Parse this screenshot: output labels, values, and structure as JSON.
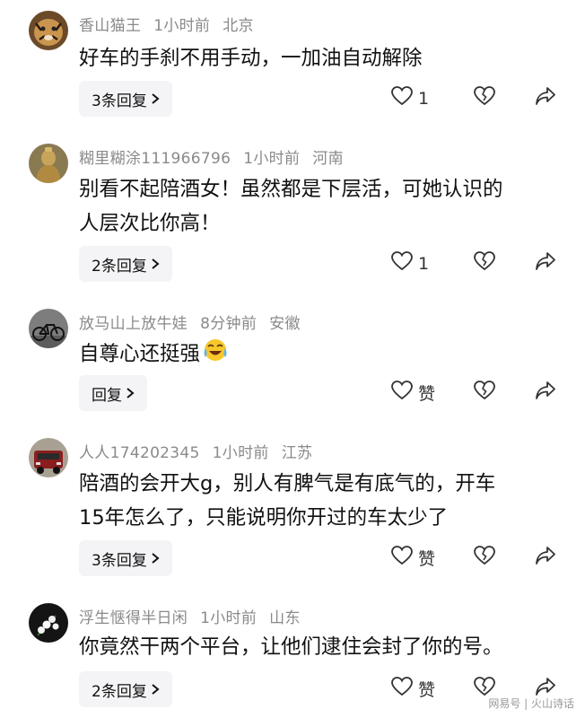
{
  "comments": [
    {
      "username": "香山猫王",
      "time": "1小时前",
      "location": "北京",
      "lines": [
        "好车的手刹不用手动，一加油自动解除"
      ],
      "reply_label": "3条回复",
      "like_label": "1",
      "avatar": "tiger-avatar"
    },
    {
      "username": "糊里糊涂111966796",
      "time": "1小时前",
      "location": "河南",
      "lines": [
        "别看不起陪酒女！虽然都是下层活，可她认识的",
        "人层次比你高！"
      ],
      "reply_label": "2条回复",
      "like_label": "1",
      "avatar": "statue-avatar"
    },
    {
      "username": "放马山上放牛娃",
      "time": "8分钟前",
      "location": "安徽",
      "lines": [
        "自尊心还挺强"
      ],
      "emoji": "laughing-crying-emoji",
      "reply_label": "回复",
      "like_label": "赞",
      "avatar": "bicycle-avatar"
    },
    {
      "username": "人人174202345",
      "time": "1小时前",
      "location": "江苏",
      "lines": [
        "陪酒的会开大g，别人有脾气是有底气的，开车",
        "15年怎么了，只能说明你开过的车太少了"
      ],
      "reply_label": "3条回复",
      "like_label": "赞",
      "avatar": "suv-avatar"
    },
    {
      "username": "浮生惬得半日闲",
      "time": "1小时前",
      "location": "山东",
      "lines": [
        "你竟然干两个平台，让他们逮住会封了你的号。"
      ],
      "reply_label": "2条回复",
      "like_label": "赞",
      "avatar": "flowers-avatar"
    }
  ],
  "watermark": "网易号 | 火山诗话",
  "colors": {
    "meta": "#8a8a8a",
    "text": "#111111",
    "reply_bg": "#f4f4f6",
    "icon": "#333333"
  }
}
